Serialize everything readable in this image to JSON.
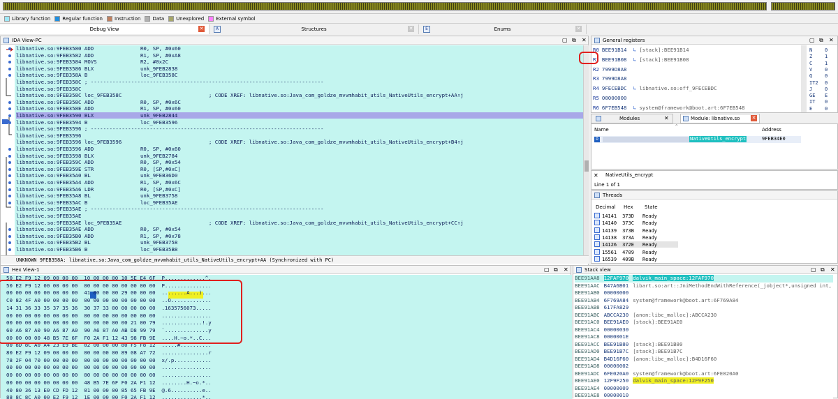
{
  "legend": [
    {
      "label": "Library function",
      "color": "#9ee8f8"
    },
    {
      "label": "Regular function",
      "color": "#1f8fe0"
    },
    {
      "label": "Instruction",
      "color": "#c08060"
    },
    {
      "label": "Data",
      "color": "#b0b0b0"
    },
    {
      "label": "Unexplored",
      "color": "#a6a66a"
    },
    {
      "label": "External symbol",
      "color": "#ff80ff"
    }
  ],
  "tabs": [
    {
      "label": "Debug View"
    },
    {
      "label": "Structures"
    },
    {
      "label": "Enums"
    }
  ],
  "ida": {
    "title": "IDA View-PC",
    "lines": [
      "libnative.so:9FEB3580 ADD               R0, SP, #0x60",
      "libnative.so:9FEB3582 ADD               R1, SP, #0xA8",
      "libnative.so:9FEB3584 MOVS              R2, #0x2C",
      "libnative.so:9FEB3586 BLX               unk_9FEB2838",
      "libnative.so:9FEB358A B                 loc_9FEB358C",
      "libnative.so:9FEB358C ; ---------------------------------------------------------------------------",
      "libnative.so:9FEB358C",
      "libnative.so:9FEB358C loc_9FEB358C                            ; CODE XREF: libnative.so:Java_com_goldze_mvvmhabit_utils_NativeUtils_encrypt+AA↑j",
      "libnative.so:9FEB358C ADD               R0, SP, #0x6C",
      "libnative.so:9FEB358E ADD               R1, SP, #0x60",
      "libnative.so:9FEB3590 BLX               unk_9FEB2844",
      "libnative.so:9FEB3594 B                 loc_9FEB3596",
      "libnative.so:9FEB3596 ; ---------------------------------------------------------------------------",
      "libnative.so:9FEB3596",
      "libnative.so:9FEB3596 loc_9FEB3596                            ; CODE XREF: libnative.so:Java_com_goldze_mvvmhabit_utils_NativeUtils_encrypt+B4↑j",
      "libnative.so:9FEB3596 ADD               R0, SP, #0x60",
      "libnative.so:9FEB3598 BLX               unk_9FEB2784",
      "libnative.so:9FEB359C ADD               R0, SP, #0x54",
      "libnative.so:9FEB359E STR               R0, [SP,#0xC]",
      "libnative.so:9FEB35A0 BL                unk_9FEB36D0",
      "libnative.so:9FEB35A4 ADD               R1, SP, #0x6C",
      "libnative.so:9FEB35A6 LDR               R0, [SP,#0xC]",
      "libnative.so:9FEB35A8 BL                unk_9FEB3758",
      "libnative.so:9FEB35AC B                 loc_9FEB35AE",
      "libnative.so:9FEB35AE ; ---------------------------------------------------------------------------",
      "libnative.so:9FEB35AE",
      "libnative.so:9FEB35AE loc_9FEB35AE                            ; CODE XREF: libnative.so:Java_com_goldze_mvvmhabit_utils_NativeUtils_encrypt+CC↑j",
      "libnative.so:9FEB35AE ADD               R0, SP, #0x54",
      "libnative.so:9FEB35B0 ADD               R1, SP, #0x78",
      "libnative.so:9FEB35B2 BL                unk_9FEB3758",
      "libnative.so:9FEB35B6 B                 loc_9FEB35B8"
    ],
    "status": "UNKNOWN 9FEB358A: libnative.so:Java_com_goldze_mvvmhabit_utils_NativeUtils_encrypt+AA (Synchronized with PC)"
  },
  "registers": {
    "title": "General registers",
    "rows": [
      {
        "name": "R0",
        "value": "BEE91B14",
        "comment": "[stack]:BEE91B14"
      },
      {
        "name": "R1",
        "value": "BEE91B08",
        "comment": "[stack]:BEE91B08"
      },
      {
        "name": "R2",
        "value": "7999D8A8",
        "comment": ""
      },
      {
        "name": "R3",
        "value": "7999D8A8",
        "comment": ""
      },
      {
        "name": "R4",
        "value": "9FECEBDC",
        "comment": "libnative.so:off_9FECEBDC"
      },
      {
        "name": "R5",
        "value": "00000000",
        "comment": ""
      },
      {
        "name": "R6",
        "value": "6F7EB548",
        "comment": "system@framework@boot.art:6F7EB548"
      }
    ],
    "flags": [
      {
        "name": "N",
        "value": "0"
      },
      {
        "name": "Z",
        "value": "1"
      },
      {
        "name": "C",
        "value": "1"
      },
      {
        "name": "V",
        "value": "0"
      },
      {
        "name": "Q",
        "value": "0"
      },
      {
        "name": "IT2",
        "value": "0"
      },
      {
        "name": "J",
        "value": "0"
      },
      {
        "name": "GE",
        "value": "E"
      },
      {
        "name": "IT",
        "value": "0"
      },
      {
        "name": "E",
        "value": "0"
      }
    ]
  },
  "modules": {
    "tab1": "Modules",
    "tab2": "Module: libnative.so",
    "col_name": "Name",
    "col_address": "Address",
    "row_name": "NativeUtils_encrypt",
    "row_address": "9FEB34E0"
  },
  "search": {
    "text": "NativeUtils_encrypt",
    "result": "Line 1 of 1"
  },
  "threads": {
    "title": "Threads",
    "cols": [
      "Decimal",
      "Hex",
      "State"
    ],
    "rows": [
      {
        "dec": "14141",
        "hex": "373D",
        "state": "Ready"
      },
      {
        "dec": "14140",
        "hex": "373C",
        "state": "Ready"
      },
      {
        "dec": "14139",
        "hex": "373B",
        "state": "Ready"
      },
      {
        "dec": "14138",
        "hex": "373A",
        "state": "Ready"
      },
      {
        "dec": "14126",
        "hex": "372E",
        "state": "Ready"
      },
      {
        "dec": "15561",
        "hex": "4709",
        "state": "Ready"
      },
      {
        "dec": "16539",
        "hex": "409B",
        "state": "Ready"
      }
    ]
  },
  "hex": {
    "title": "Hex View-1",
    "lines": [
      "50 E2 F9 12 09 00 00 00  10 00 00 00 10 5E E4 6F  P.............^.",
      "50 E2 F9 12 00 00 00 00  00 00 00 00 00 00 00 00  P...............",
      "00 00 00 00 00 00 00 00  41 00 00 00 29 00 00 00  ........A...)...",
      "C0 82 4F A0 00 00 00 00  00 00 00 00 00 00 00 00  ..O.............",
      "14 31 36 33 35 37 35 36  30 37 33 00 00 00 00 00  .1635756073.....",
      "00 00 00 00 00 00 00 00  00 00 00 00 00 00 00 00  ................",
      "00 00 00 00 00 00 00 00  00 00 00 00 00 21 00 79  .............!.y",
      "60 A6 87 A0 90 A6 87 A0  90 A6 87 A0 AB D8 99 79  `..............y",
      "00 00 00 00 48 B5 7E 6F  F0 2A F1 12 43 98 FB 9E  ....H.~o.*..C...",
      "00 8D 8C A0 A4 23 E9 BE  02 00 00 00 80 F5 F8 12  .....#..........",
      "80 E2 F9 12 09 00 00 00  00 00 00 00 89 08 A7 72  ...............r",
      "78 2F 04 70 00 00 00 00  00 00 00 00 00 00 00 00  x/.p............",
      "00 00 00 00 00 00 00 00  00 00 00 00 00 00 00 00  ................",
      "00 00 00 00 00 00 00 00  00 00 00 00 00 00 00 00  ................",
      "00 00 00 00 00 00 00 00  48 B5 7E 6F F0 2A F1 12  ........H.~o.*..",
      "40 80 36 13 E0 CD FD 12  01 00 00 00 85 65 FB 9E  @.6..........e..",
      "88 8C 8C A0 00 E2 F9 12  1E 00 00 00 F0 2A F1 12  .............*.."
    ]
  },
  "stack": {
    "title": "Stack view",
    "lines": [
      {
        "addr": "BEE91AA8",
        "val": "12FAF970",
        "comment": "dalvik_main_space:12FAF970"
      },
      {
        "addr": "BEE91AAC",
        "val": "B47A6B01",
        "comment": "libart.so:art::JniMethodEndWithReference(_jobject*,unsigned int,"
      },
      {
        "addr": "BEE91AB0",
        "val": "00000000",
        "comment": ""
      },
      {
        "addr": "BEE91AB4",
        "val": "6F769A84",
        "comment": "system@framework@boot.art:6F769A84"
      },
      {
        "addr": "BEE91AB8",
        "val": "617FA829",
        "comment": ""
      },
      {
        "addr": "BEE91ABC",
        "val": "ABCCA230",
        "comment": "[anon:libc_malloc]:ABCCA230"
      },
      {
        "addr": "BEE91AC0",
        "val": "BEE91AE0",
        "comment": "[stack]:BEE91AE0"
      },
      {
        "addr": "BEE91AC4",
        "val": "00000030",
        "comment": ""
      },
      {
        "addr": "BEE91AC8",
        "val": "0000001E",
        "comment": ""
      },
      {
        "addr": "BEE91ACC",
        "val": "BEE91B80",
        "comment": "[stack]:BEE91B80"
      },
      {
        "addr": "BEE91AD0",
        "val": "BEE91B7C",
        "comment": "[stack]:BEE91B7C"
      },
      {
        "addr": "BEE91AD4",
        "val": "B4D16F60",
        "comment": "[anon:libc_malloc]:B4D16F60"
      },
      {
        "addr": "BEE91AD8",
        "val": "00000002",
        "comment": ""
      },
      {
        "addr": "BEE91ADC",
        "val": "6FE020A0",
        "comment": "system@framework@boot.art:6FE020A0"
      },
      {
        "addr": "BEE91AE0",
        "val": "12F9F250",
        "comment": "dalvik_main_space:12F9F250"
      },
      {
        "addr": "BEE91AE4",
        "val": "00000009",
        "comment": ""
      },
      {
        "addr": "BEE91AE8",
        "val": "00000010",
        "comment": ""
      },
      {
        "addr": "BEE91AEC",
        "val": "6FE45E10",
        "comment": "system@framework@boot.art:6FE45E10"
      }
    ]
  }
}
